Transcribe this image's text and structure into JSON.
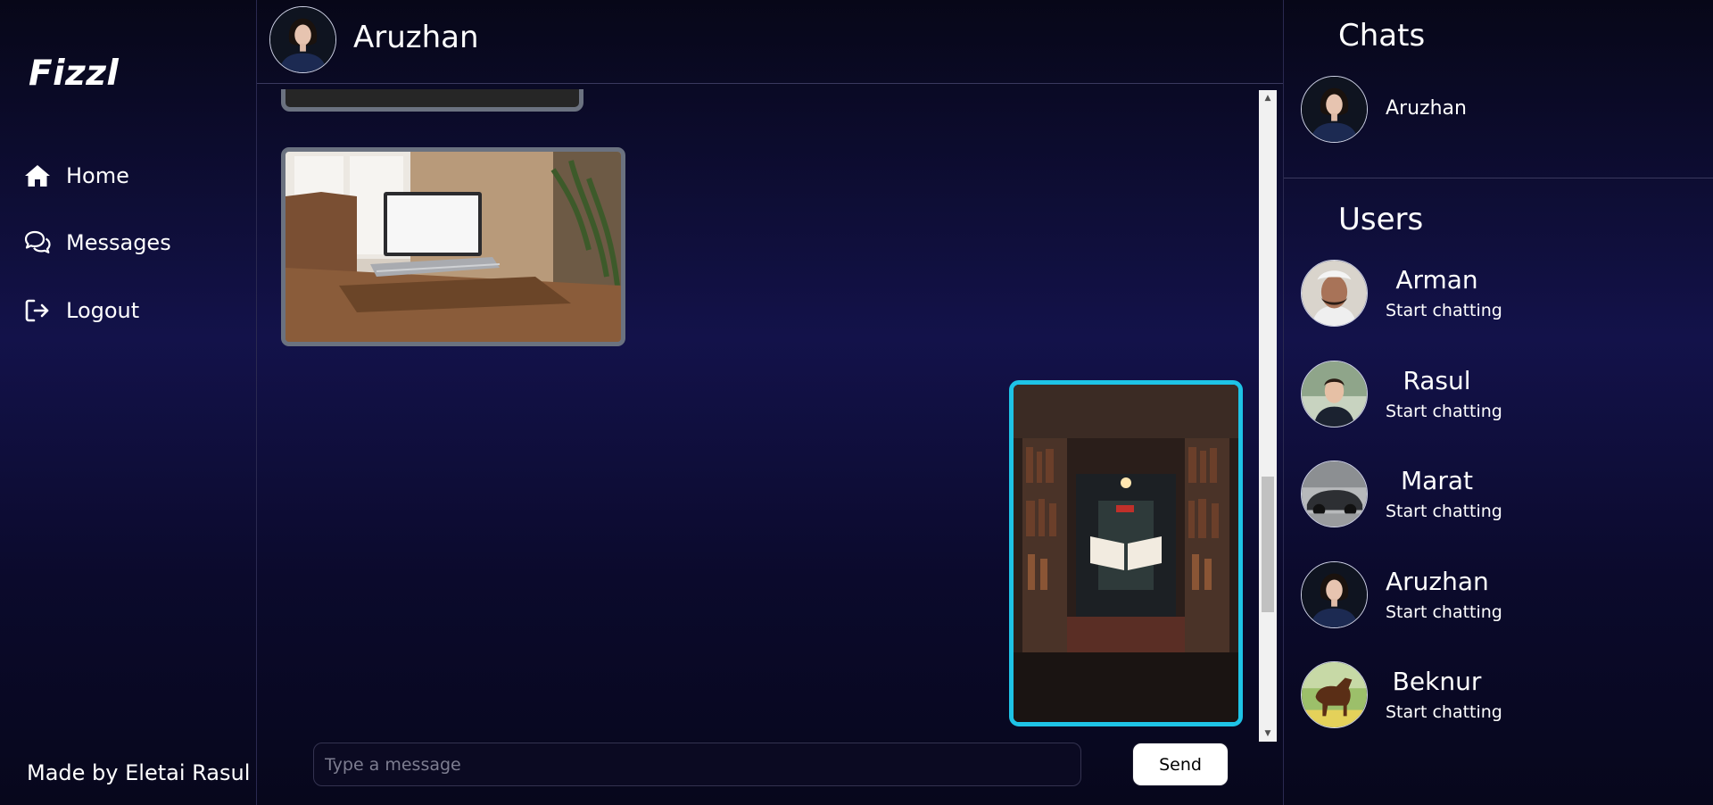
{
  "sidebar": {
    "brand": "Fizzl",
    "nav": [
      {
        "label": "Home",
        "icon": "home-icon"
      },
      {
        "label": "Messages",
        "icon": "chat-bubbles-icon"
      },
      {
        "label": "Logout",
        "icon": "logout-icon"
      }
    ],
    "credit": "Made by Eletai Rasul"
  },
  "chat": {
    "title": "Aruzhan",
    "messages": [
      {
        "type": "image",
        "subject": "",
        "side": "left"
      },
      {
        "type": "image",
        "subject": "laptop",
        "side": "left"
      },
      {
        "type": "image",
        "subject": "library book",
        "side": "right"
      }
    ],
    "input_placeholder": "Type a message",
    "input_value": "",
    "send_label": "Send"
  },
  "right_panel": {
    "chats_title": "Chats",
    "chats": [
      {
        "name": "Aruzhan"
      }
    ],
    "users_title": "Users",
    "users": [
      {
        "name": "Arman",
        "sub": "Start chatting"
      },
      {
        "name": "Rasul",
        "sub": "Start chatting"
      },
      {
        "name": "Marat",
        "sub": "Start chatting"
      },
      {
        "name": "Aruzhan",
        "sub": "Start chatting"
      },
      {
        "name": "Beknur",
        "sub": "Start chatting"
      }
    ]
  },
  "colors": {
    "background": "#13124a",
    "accent_border": "#1ec3e6",
    "received_border": "#6b7280",
    "send_button": "#ffffff"
  }
}
